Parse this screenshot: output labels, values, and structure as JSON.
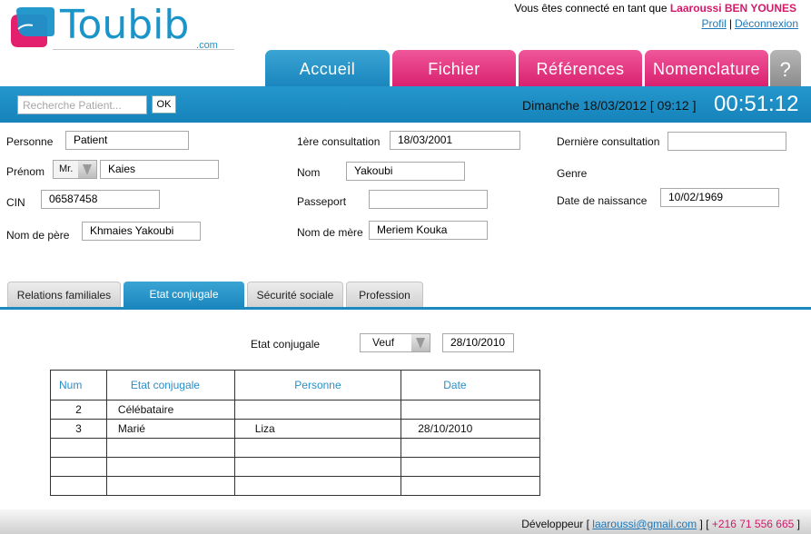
{
  "header": {
    "logo_word": "Toubib",
    "logo_com": "com",
    "connected_prefix": "Vous êtes connecté en tant que",
    "user_name": "Laaroussi BEN YOUNES",
    "profile_link": "Profil",
    "separator": "|",
    "logout_link": "Déconnexion"
  },
  "nav": {
    "tabs": [
      "Accueil",
      "Fichier",
      "Références",
      "Nomenclature",
      "?"
    ],
    "active": "Accueil"
  },
  "toolbar": {
    "search_placeholder": "Recherche Patient...",
    "ok_label": "OK",
    "date_text": "Dimanche 18/03/2012 [ 09:12 ]",
    "clock": "00:51:12"
  },
  "form": {
    "personne_label": "Personne",
    "personne_value": "Patient",
    "premiere_consult_label": "1ère consultation",
    "premiere_consult_value": "18/03/2001",
    "derniere_consult_label": "Dernière consultation",
    "derniere_consult_value": "",
    "prenom_label": "Prénom",
    "civilite_value": "Mr.",
    "prenom_value": "Kaies",
    "nom_label": "Nom",
    "nom_value": "Yakoubi",
    "genre_label": "Genre",
    "cin_label": "CIN",
    "cin_value": "06587458",
    "passeport_label": "Passeport",
    "passeport_value": "",
    "dob_label": "Date de naissance",
    "dob_value": "10/02/1969",
    "pere_label": "Nom de père",
    "pere_value": "Khmaies Yakoubi",
    "mere_label": "Nom de mère",
    "mere_value": "Meriem Kouka"
  },
  "subtabs": {
    "items": [
      "Relations familiales",
      "Etat conjugale",
      "Sécurité sociale",
      "Profession"
    ],
    "active": "Etat conjugale"
  },
  "etat": {
    "label": "Etat conjugale",
    "select_value": "Veuf",
    "date_value": "28/10/2010"
  },
  "table": {
    "headers": [
      "Num",
      "Etat conjugale",
      "Personne",
      "Date"
    ],
    "rows": [
      [
        "2",
        "Célébataire",
        "",
        ""
      ],
      [
        "3",
        "Marié",
        "Liza",
        "28/10/2010"
      ],
      [
        "",
        "",
        "",
        ""
      ],
      [
        "",
        "",
        "",
        ""
      ],
      [
        "",
        "",
        "",
        ""
      ]
    ]
  },
  "footer": {
    "dev_label": "Développeur [",
    "email": "laaroussi@gmail.com",
    "mid": "] [",
    "phone": "+216 71 556 665",
    "end": "]"
  },
  "colors": {
    "brand_blue": "#1a94c9",
    "brand_pink": "#d9216f",
    "help_gray": "#a0a0a0"
  }
}
